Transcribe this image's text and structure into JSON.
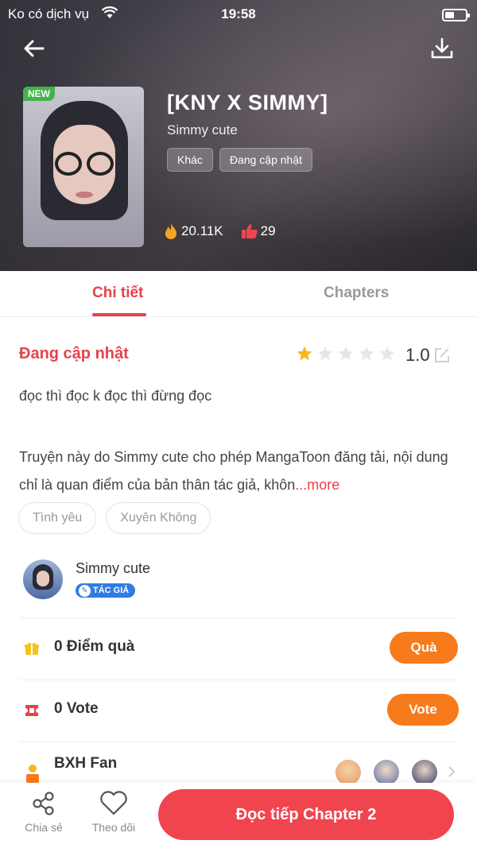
{
  "status_bar": {
    "carrier": "Ko có dịch vụ",
    "time": "19:58"
  },
  "book": {
    "title": "[KNY X SIMMY]",
    "author": "Simmy cute",
    "new_badge": "NEW",
    "tags": [
      "Khác",
      "Đang cập nhật"
    ],
    "views": "20.11K",
    "likes": "29"
  },
  "tabs": [
    {
      "label": "Chi tiết",
      "active": true
    },
    {
      "label": "Chapters",
      "active": false
    }
  ],
  "detail": {
    "status": "Đang cập nhật",
    "rating": "1.0",
    "stars_filled": 1,
    "stars_total": 5,
    "description_line1": "đọc thì đọc k đọc thì đừng đọc",
    "description_line2": "Truyện này do Simmy cute cho phép MangaToon đăng tải, nội dung chỉ là quan điểm của bản thân tác giả, khôn",
    "more_label": "...more",
    "genres": [
      "Tình yêu",
      "Xuyên Không"
    ]
  },
  "author_section": {
    "name": "Simmy cute",
    "badge": "TÁC GIẢ"
  },
  "gift": {
    "label": "0 Điểm quà",
    "button": "Quà"
  },
  "vote": {
    "label": "0 Vote",
    "button": "Vote"
  },
  "fan": {
    "label": "BXH Fan"
  },
  "bottom_bar": {
    "share_label": "Chia sẻ",
    "follow_label": "Theo dõi",
    "read_button": "Đọc tiếp Chapter 2"
  },
  "colors": {
    "accent": "#e8414a",
    "orange": "#f77a1b",
    "read_button": "#f0454f",
    "badge_blue": "#2f7de1",
    "new_green": "#44b24a"
  }
}
